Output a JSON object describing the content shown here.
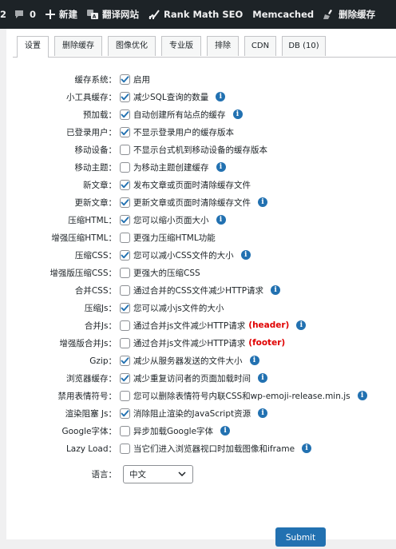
{
  "adminbar": {
    "count_prefix": "2",
    "comments_count": "0",
    "new_label": "新建",
    "translate_label": "翻译网站",
    "rankmath_label": "Rank Math SEO",
    "memcached_label": "Memcached",
    "clear_cache_label": "删除缓存"
  },
  "tabs": [
    "设置",
    "删除缓存",
    "图像优化",
    "专业版",
    "排除",
    "CDN",
    "DB (10)"
  ],
  "settings": [
    {
      "label": "缓存系统：",
      "checked": true,
      "desc": "启用",
      "info": false,
      "tag": ""
    },
    {
      "label": "小工具缓存：",
      "checked": true,
      "desc": "减少SQL查询的数量",
      "info": true,
      "tag": ""
    },
    {
      "label": "预加载：",
      "checked": true,
      "desc": "自动创建所有站点的缓存",
      "info": true,
      "tag": ""
    },
    {
      "label": "已登录用户：",
      "checked": true,
      "desc": "不显示登录用户的缓存版本",
      "info": false,
      "tag": ""
    },
    {
      "label": "移动设备：",
      "checked": false,
      "desc": "不显示台式机到移动设备的缓存版本",
      "info": false,
      "tag": ""
    },
    {
      "label": "移动主题：",
      "checked": false,
      "desc": "为移动主题创建缓存",
      "info": true,
      "tag": ""
    },
    {
      "label": "新文章：",
      "checked": true,
      "desc": "发布文章或页面时清除缓存文件",
      "info": false,
      "tag": ""
    },
    {
      "label": "更新文章：",
      "checked": true,
      "desc": "更新文章或页面时清除缓存文件",
      "info": true,
      "tag": ""
    },
    {
      "label": "压缩HTML：",
      "checked": true,
      "desc": "您可以缩小页面大小",
      "info": true,
      "tag": ""
    },
    {
      "label": "增强压缩HTML：",
      "checked": false,
      "desc": "更强力压缩HTML功能",
      "info": false,
      "tag": ""
    },
    {
      "label": "压缩CSS：",
      "checked": true,
      "desc": "您可以减小CSS文件的大小",
      "info": true,
      "tag": ""
    },
    {
      "label": "增强版压缩CSS：",
      "checked": false,
      "desc": "更强大的压缩CSS",
      "info": false,
      "tag": ""
    },
    {
      "label": "合并CSS：",
      "checked": false,
      "desc": "通过合并的CSS文件减少HTTP请求",
      "info": true,
      "tag": ""
    },
    {
      "label": "压缩Js：",
      "checked": true,
      "desc": "您可以减小js文件的大小",
      "info": false,
      "tag": ""
    },
    {
      "label": "合并Js：",
      "checked": false,
      "desc": "通过合并js文件减少HTTP请求",
      "info": true,
      "tag": "(header)"
    },
    {
      "label": "增强版合并Js：",
      "checked": false,
      "desc": "通过合并js文件减少HTTP请求",
      "info": false,
      "tag": "(footer)"
    },
    {
      "label": "Gzip：",
      "checked": true,
      "desc": "减少从服务器发送的文件大小",
      "info": true,
      "tag": ""
    },
    {
      "label": "浏览器缓存：",
      "checked": true,
      "desc": "减少重复访问者的页面加载时间",
      "info": true,
      "tag": ""
    },
    {
      "label": "禁用表情符号：",
      "checked": false,
      "desc": "您可以删除表情符号内联CSS和wp-emoji-release.min.js",
      "info": true,
      "tag": ""
    },
    {
      "label": "渲染阻塞 Js：",
      "checked": true,
      "desc": "消除阻止渲染的JavaScript资源",
      "info": true,
      "tag": ""
    },
    {
      "label": "Google字体：",
      "checked": false,
      "desc": "异步加载Google字体",
      "info": true,
      "tag": ""
    },
    {
      "label": "Lazy Load：",
      "checked": false,
      "desc": "当它们进入浏览器视口时加载图像和iframe",
      "info": true,
      "tag": ""
    }
  ],
  "language": {
    "label": "语言：",
    "selected": "中文"
  },
  "submit_label": "Submit",
  "info_glyph": "i",
  "colors": {
    "adminbar": "#1d2327",
    "accent": "#2271b1",
    "tag": "#e00000"
  }
}
